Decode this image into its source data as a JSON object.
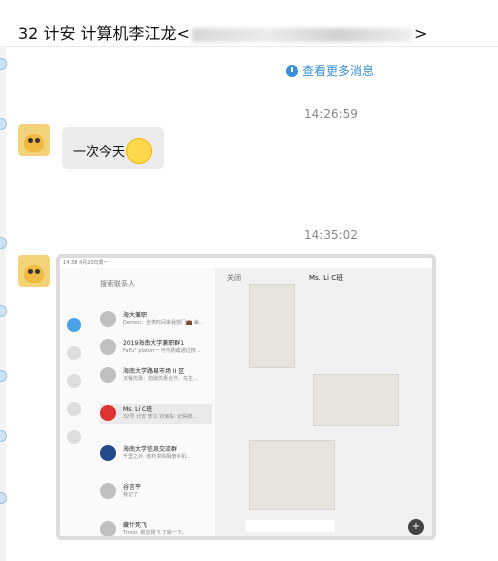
{
  "title": {
    "prefix": "32 计安 计算机李江龙<",
    "suffix": ">"
  },
  "more_messages": "查看更多消息",
  "messages": [
    {
      "time": "14:26:59",
      "text": "一次今天"
    },
    {
      "time": "14:35:02"
    }
  ],
  "screenshot": {
    "status": "14:38  4月20日周一",
    "search_placeholder": "搜索联系人",
    "close_label": "关闭",
    "chat_title": "Ms. Li C班",
    "contacts": [
      {
        "name": "海大兼职",
        "preview": "Demon：全类时间来我部门💼 兼..."
      },
      {
        "name": "2019海南大学兼职群1",
        "preview": "FaFu° platon一 可代购或通过搜..."
      },
      {
        "name": "海南大学路易市场 II 区",
        "preview": "法餐优惠：拍摄优惠合作，先生..."
      },
      {
        "name": "Ms. Li C班",
        "preview": "32号 计安 李江 刘海东: 记得按..."
      },
      {
        "name": "海南大学信息交流群",
        "preview": "千里之外: 南朴求购相册手机..."
      },
      {
        "name": "谷言平",
        "preview": "我记了"
      },
      {
        "name": "藏什死飞",
        "preview": "Tmoo: 那应我飞 了就一下。"
      }
    ]
  }
}
